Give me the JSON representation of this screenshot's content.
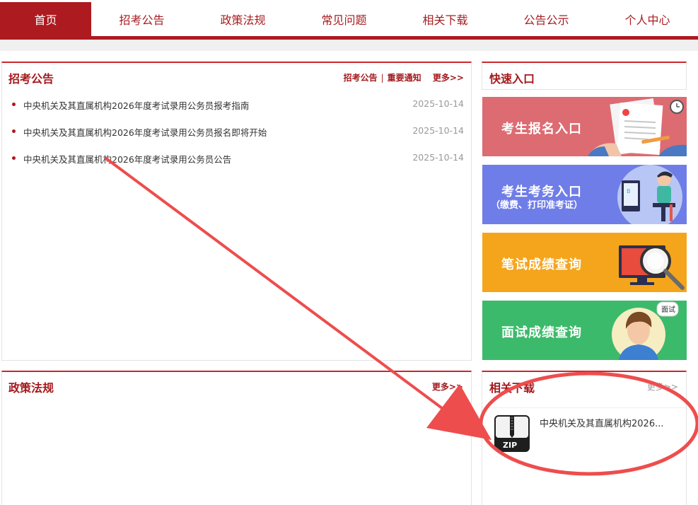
{
  "nav": {
    "items": [
      {
        "label": "首页",
        "active": true
      },
      {
        "label": "招考公告",
        "active": false
      },
      {
        "label": "政策法规",
        "active": false
      },
      {
        "label": "常见问题",
        "active": false
      },
      {
        "label": "相关下载",
        "active": false
      },
      {
        "label": "公告公示",
        "active": false
      },
      {
        "label": "个人中心",
        "active": false
      }
    ]
  },
  "announcements": {
    "title": "招考公告",
    "link1": "招考公告",
    "sep": "|",
    "link2": "重要通知",
    "more": "更多>>",
    "items": [
      {
        "title": "中央机关及其直属机构2026年度考试录用公务员报考指南",
        "date": "2025-10-14"
      },
      {
        "title": "中央机关及其直属机构2026年度考试录用公务员报名即将开始",
        "date": "2025-10-14"
      },
      {
        "title": "中央机关及其直属机构2026年度考试录用公务员公告",
        "date": "2025-10-14"
      }
    ]
  },
  "policy": {
    "title": "政策法规",
    "more": "更多>>"
  },
  "quick": {
    "title": "快速入口",
    "tiles": [
      {
        "label": "考生报名入口",
        "sub": "",
        "color": "#dd6b72",
        "icon": "document-sign-icon"
      },
      {
        "label": "考生考务入口",
        "sub": "（缴费、打印准考证）",
        "color": "#6f7de8",
        "icon": "computer-user-icon"
      },
      {
        "label": "笔试成绩查询",
        "sub": "",
        "color": "#f5a51b",
        "icon": "magnifier-monitor-icon"
      },
      {
        "label": "面试成绩查询",
        "sub": "",
        "color": "#3cba6b",
        "icon": "interview-person-icon"
      }
    ]
  },
  "downloads": {
    "title": "相关下载",
    "more": "更多>>",
    "items": [
      {
        "name": "中央机关及其直属机构2026...",
        "icon_text": "ZIP"
      }
    ]
  },
  "colors": {
    "brand_red": "#ad1a1f",
    "annotation_red": "#ee4d4d"
  }
}
